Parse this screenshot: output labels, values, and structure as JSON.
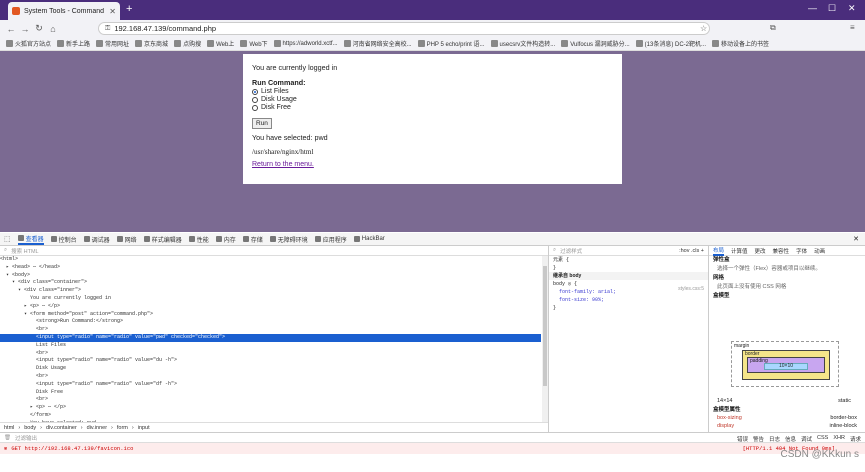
{
  "browser": {
    "tab_title": "System Tools - Command",
    "url": "192.168.47.139/command.php",
    "bookmarks": [
      "火狐官方站点",
      "新手上路",
      "常用网址",
      "京东商城",
      "点购搜",
      "Web上",
      "Web下",
      "https://adworld.xctf...",
      "河南省网络安全高校...",
      "PHP 5 echo/print 语...",
      "usecsrv文件构造转...",
      "Vulfocus 漏洞威胁分...",
      "(13条消息) DC-2靶机...",
      "移动设备上的书签"
    ]
  },
  "page": {
    "logged_in": "You are currently logged in",
    "run_heading": "Run Command:",
    "options": [
      {
        "label": "List Files",
        "checked": true
      },
      {
        "label": "Disk Usage",
        "checked": false
      },
      {
        "label": "Disk Free",
        "checked": false
      }
    ],
    "run_button": "Run",
    "selected_text": "You have selected: pwd",
    "output": "/usr/share/nginx/html",
    "return_link": "Return to the menu."
  },
  "devtools": {
    "tabs": [
      "查看器",
      "控制台",
      "调试器",
      "网络",
      "样式编辑器",
      "性能",
      "内存",
      "存储",
      "无障碍环境",
      "应用程序",
      "HackBar"
    ],
    "search_placeholder": "搜索 HTML",
    "html_lines": [
      "<html>",
      "  ▸ <head> ⋯ </head>",
      "  ▾ <body>",
      "    ▾ <div class=\"container\">",
      "      ▾ <div class=\"inner\">",
      "          You are currently logged in",
      "        ▸ <p> ⋯ </p>",
      "        ▾ <form method=\"post\" action=\"command.php\">",
      "            <strong>Run Command:</strong>",
      "            <br>",
      "            <input type=\"radio\" name=\"radio\" value=\"pwd\" checked=\"checked\">",
      "            List Files",
      "            <br>",
      "            <input type=\"radio\" name=\"radio\" value=\"du -h\">",
      "            Disk Usage",
      "            <br>",
      "            <input type=\"radio\" name=\"radio\" value=\"df -h\">",
      "            Disk Free",
      "            <br>",
      "          ▸ <p> ⋯ </p>",
      "          </form>",
      "          You have selected: pwd",
      "          <br>"
    ],
    "breadcrumb": [
      "html",
      "body",
      "div.container",
      "div.inner",
      "form",
      "input"
    ],
    "rules_filter": "过滤样式",
    "rules": [
      "元素 {",
      "}",
      "继承自 body",
      "body ◎ {",
      "  font-family: arial;",
      "  font-size: 90%;",
      "}"
    ],
    "rules_source": "styles.css:5",
    "layout_tabs": [
      "布局",
      "计算值",
      "更改",
      "兼容性",
      "字体",
      "动画"
    ],
    "flex_header": "弹性盒",
    "flex_hint": "选择一个弹性（Flex）容器或项目以继续。",
    "grid_header": "网格",
    "grid_hint": "此页面上没有使用 CSS 网格",
    "box_header": "盒模型",
    "box_labels": [
      "margin",
      "border",
      "padding"
    ],
    "box_content": "10×10",
    "box_size": "14×14",
    "box_position": "static",
    "box_props_header": "盒模型属性",
    "box_props": [
      [
        "box-sizing",
        "border-box"
      ],
      [
        "display",
        "inline-block"
      ]
    ],
    "console_filter": "过滤输出",
    "console_filters": [
      "错误",
      "警告",
      "日志",
      "信息",
      "调试",
      "CSS",
      "XHR",
      "请求"
    ],
    "console_error": "GET http://192.168.47.139/favicon.ico",
    "console_status": "[HTTP/1.1 404 Not Found 0ms]"
  },
  "watermark": "CSDN @KKkun s"
}
